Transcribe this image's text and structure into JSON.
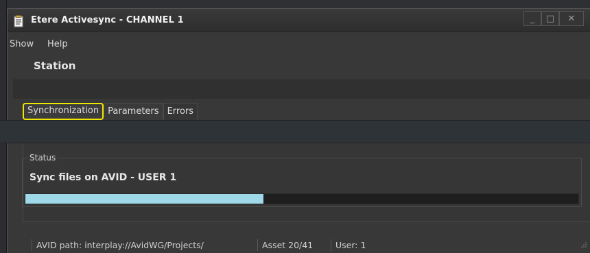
{
  "window": {
    "title": "Etere Activesync - CHANNEL 1",
    "controls": {
      "minimize": "_",
      "maximize": "□",
      "close": "✕"
    }
  },
  "menu": {
    "items": [
      "Show",
      "Help"
    ]
  },
  "station_label": "Station",
  "tabs": [
    {
      "label": "Synchronization",
      "active": true
    },
    {
      "label": "Parameters",
      "active": false
    },
    {
      "label": "Errors",
      "active": false
    }
  ],
  "status": {
    "legend": "Status",
    "text": "Sync files on AVID  -  USER 1",
    "progress_fraction": 0.43,
    "progress_color": "#9fd8e8"
  },
  "statusbar": {
    "avid_path": "AVID path: interplay://AvidWG/Projects/",
    "asset": "Asset 20/41",
    "user": "User: 1"
  },
  "colors": {
    "highlight": "#f1e600",
    "background": "#383838"
  }
}
